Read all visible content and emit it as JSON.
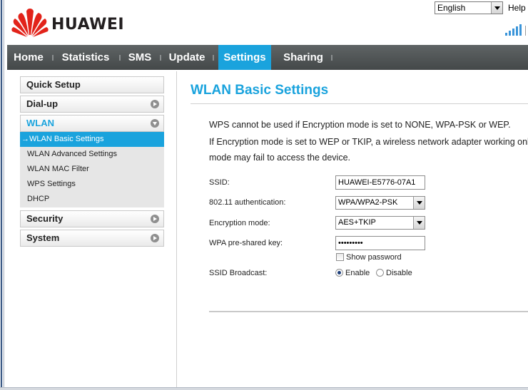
{
  "header": {
    "brand": "HUAWEI",
    "language": "English",
    "help": "Help"
  },
  "nav": {
    "items": [
      {
        "label": "Home"
      },
      {
        "label": "Statistics"
      },
      {
        "label": "SMS"
      },
      {
        "label": "Update"
      },
      {
        "label": "Settings",
        "active": true
      },
      {
        "label": "Sharing"
      }
    ]
  },
  "sidebar": {
    "quick_setup": "Quick Setup",
    "dialup": "Dial-up",
    "wlan": "WLAN",
    "wlan_items": [
      "→WLAN Basic Settings",
      "WLAN Advanced Settings",
      "WLAN MAC Filter",
      "WPS Settings",
      "DHCP"
    ],
    "security": "Security",
    "system": "System"
  },
  "main": {
    "title": "WLAN Basic Settings",
    "info_line1": "WPS cannot be used if Encryption mode is set to NONE, WPA-PSK or WEP.",
    "info_line2": "If Encryption mode is set to WEP or TKIP, a wireless network adapter working onl",
    "info_line3": "mode may fail to access the device.",
    "ssid_label": "SSID:",
    "ssid_value": "HUAWEI-E5776-07A1",
    "auth_label": "802.11 authentication:",
    "auth_value": "WPA/WPA2-PSK",
    "enc_label": "Encryption mode:",
    "enc_value": "AES+TKIP",
    "psk_label": "WPA pre-shared key:",
    "psk_value": "•••••••••",
    "show_password": "Show password",
    "broadcast_label": "SSID Broadcast:",
    "enable": "Enable",
    "disable": "Disable"
  },
  "colors": {
    "accent": "#1aa3dd",
    "nav_bg": "#505455",
    "brand_red": "#e2231a"
  }
}
